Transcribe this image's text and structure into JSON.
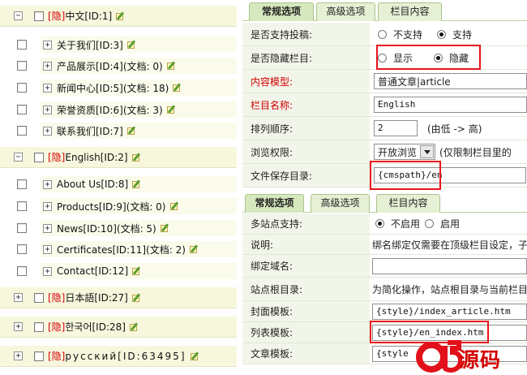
{
  "tree": {
    "items": [
      {
        "hidden": "[隐]",
        "label": "中文[ID:1]"
      },
      {
        "label": "关于我们[ID:3]"
      },
      {
        "label": "产品展示[ID:4](文档: 0)"
      },
      {
        "label": "新闻中心[ID:5](文档: 18)"
      },
      {
        "label": "荣誉资质[ID:6](文档: 3)"
      },
      {
        "label": "联系我们[ID:7]"
      },
      {
        "hidden": "[隐]",
        "label": "English[ID:2]"
      },
      {
        "label": "About Us[ID:8]"
      },
      {
        "label": "Products[ID:9](文档: 0)"
      },
      {
        "label": "News[ID:10](文档: 5)"
      },
      {
        "label": "Certificates[ID:11](文档: 2)"
      },
      {
        "label": "Contact[ID:12]"
      },
      {
        "hidden": "[隐]",
        "label": "日本語[ID:27]"
      },
      {
        "hidden": "[隐]",
        "label": "한국어[ID:28]"
      },
      {
        "hidden": "[隐]",
        "label": "русский[ID:63495]"
      }
    ]
  },
  "top_panel": {
    "tabs": [
      "常规选项",
      "高级选项",
      "栏目内容"
    ],
    "allow_submit": {
      "label": "是否支持投稿:",
      "opt1": "不支持",
      "opt2": "支持"
    },
    "hidden": {
      "label": "是否隐藏栏目:",
      "opt1": "显示",
      "opt2": "隐藏"
    },
    "content_model": {
      "label": "内容模型:",
      "value": "普通文章|article"
    },
    "name": {
      "label": "栏目名称:",
      "value": "English"
    },
    "order": {
      "label": "排列顺序:",
      "value": "2",
      "hint": "(由低 -> 高)"
    },
    "browse": {
      "label": "浏览权限:",
      "value": "开放浏览",
      "hint": "(仅限制栏目里的"
    },
    "save_dir": {
      "label": "文件保存目录:",
      "value": "{cmspath}/en"
    }
  },
  "bottom_panel": {
    "tabs": [
      "常规选项",
      "高级选项",
      "栏目内容"
    ],
    "multisite": {
      "label": "多站点支持:",
      "opt1": "不启用",
      "opt2": "启用"
    },
    "note": {
      "label": "说明:",
      "value": "绑名绑定仅需要在顶级栏目设定，子"
    },
    "domain": {
      "label": "绑定域名:",
      "value": ""
    },
    "site_root": {
      "label": "站点根目录:",
      "value": "为简化操作，站点根目录与当前栏目"
    },
    "cover_tpl": {
      "label": "封面模板:",
      "value": "{style}/index_article.htm"
    },
    "list_tpl": {
      "label": "列表模板:",
      "value": "{style}/en_index.htm"
    },
    "article_tpl": {
      "label": "文章模板:",
      "value": "{style"
    }
  },
  "watermark": {
    "logo": "a5",
    "text": "源码"
  },
  "colors": {
    "accent_red": "#e8141a",
    "hidden_red": "#d30000",
    "tab_green": "#d6e8be",
    "tree_bg": "#f7f7de"
  }
}
